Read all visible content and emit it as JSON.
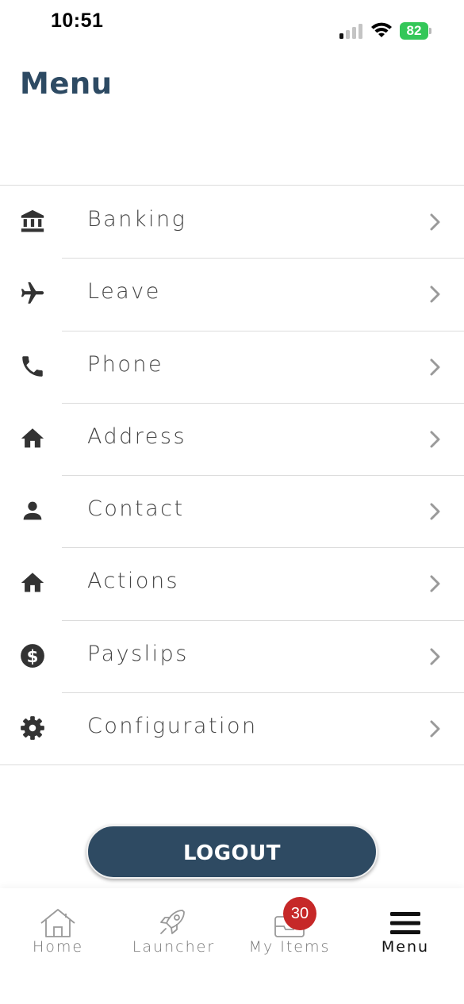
{
  "status_bar": {
    "time": "10:51",
    "battery": "82"
  },
  "page": {
    "title": "Menu"
  },
  "menu": {
    "items": [
      {
        "label": "Banking",
        "icon": "bank-icon"
      },
      {
        "label": "Leave",
        "icon": "airplane-icon"
      },
      {
        "label": "Phone",
        "icon": "phone-icon"
      },
      {
        "label": "Address",
        "icon": "home-icon"
      },
      {
        "label": "Contact",
        "icon": "person-icon"
      },
      {
        "label": "Actions",
        "icon": "home-icon"
      },
      {
        "label": "Payslips",
        "icon": "dollar-circle-icon"
      },
      {
        "label": "Configuration",
        "icon": "gear-icon"
      }
    ]
  },
  "logout": {
    "label": "LOGOUT"
  },
  "tab_bar": {
    "tabs": [
      {
        "label": "Home",
        "icon": "house-outline-icon"
      },
      {
        "label": "Launcher",
        "icon": "rocket-icon"
      },
      {
        "label": "My Items",
        "icon": "inbox-icon",
        "badge": "30"
      },
      {
        "label": "Menu",
        "icon": "hamburger-icon",
        "active": true
      }
    ]
  },
  "colors": {
    "accent": "#2e4a62",
    "title": "#2d4a63",
    "badge": "#c62828",
    "battery": "#34c759"
  }
}
